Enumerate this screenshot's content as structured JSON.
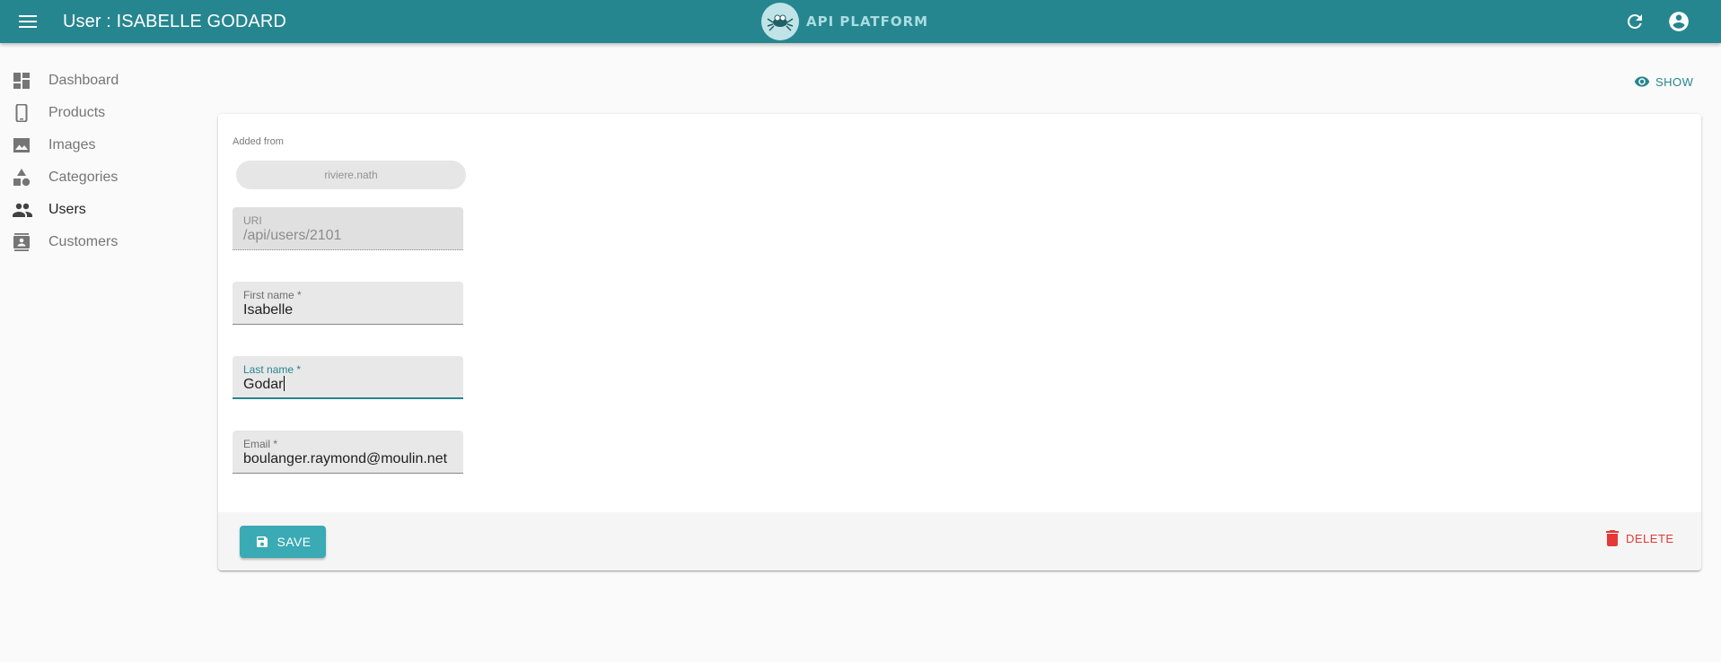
{
  "header": {
    "title": "User : ISABELLE GODARD",
    "logo_text": "API PLATFORM",
    "menu_icon": "menu-icon",
    "refresh_icon": "refresh-icon",
    "account_icon": "account-circle-icon"
  },
  "sidebar": {
    "items": [
      {
        "label": "Dashboard",
        "icon": "dashboard-icon"
      },
      {
        "label": "Products",
        "icon": "smartphone-icon"
      },
      {
        "label": "Images",
        "icon": "image-icon"
      },
      {
        "label": "Categories",
        "icon": "category-icon"
      },
      {
        "label": "Users",
        "icon": "people-icon",
        "active": true
      },
      {
        "label": "Customers",
        "icon": "contacts-icon"
      }
    ]
  },
  "actions": {
    "show_label": "SHOW"
  },
  "form": {
    "added_from_label": "Added from",
    "added_from_value": "riviere.nath",
    "uri": {
      "label": "URI",
      "value": "/api/users/2101"
    },
    "first_name": {
      "label": "First name *",
      "value": "Isabelle"
    },
    "last_name": {
      "label": "Last name *",
      "value": "Godar"
    },
    "email": {
      "label": "Email *",
      "value": "boulanger.raymond@moulin.net"
    }
  },
  "toolbar": {
    "save_label": "SAVE",
    "delete_label": "DELETE"
  },
  "colors": {
    "primary": "#26868f",
    "save_button": "#3aaab4",
    "delete": "#e53935"
  }
}
